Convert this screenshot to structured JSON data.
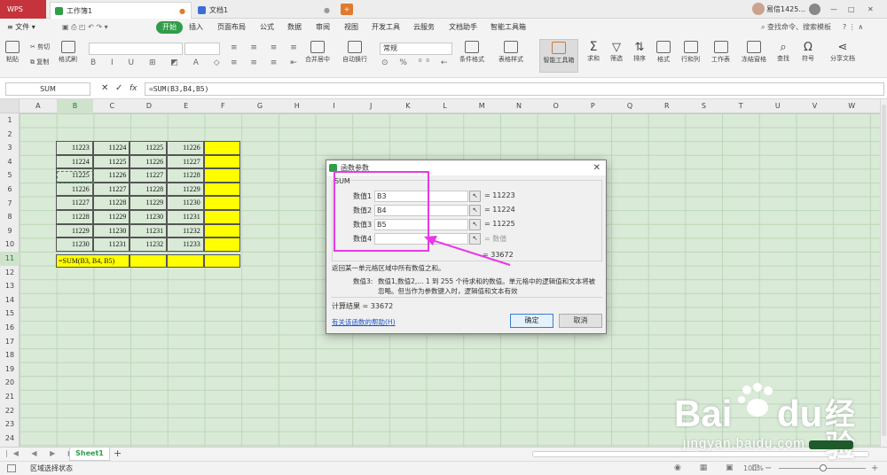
{
  "tabs": {
    "app": "WPS",
    "workbook": "工作簿1",
    "document": "文档1",
    "user": "易信1425..."
  },
  "menu": {
    "file": "文件",
    "items": [
      "开始",
      "插入",
      "页面布局",
      "公式",
      "数据",
      "审阅",
      "视图",
      "开发工具",
      "云服务",
      "文档助手",
      "智能工具箱"
    ],
    "search": "查找命令、搜索模板"
  },
  "ribbon": {
    "cut": "剪切",
    "copy": "复制",
    "paste": "粘贴",
    "format_painter": "格式刷",
    "merge": "合并居中",
    "wrap": "自动换行",
    "number_format": "常规",
    "cond_format": "条件格式",
    "table_style": "表格样式",
    "smart_toolbox": "智能工具箱",
    "sum": "求和",
    "filter": "筛选",
    "sort": "排序",
    "format": "格式",
    "rows_cols": "行和列",
    "worksheet": "工作表",
    "freeze": "冻结窗格",
    "find": "查找",
    "symbol": "符号",
    "share": "分享文档"
  },
  "formula_bar": {
    "name_box": "SUM",
    "fx": "fx",
    "formula": "=SUM(B3,B4,B5)"
  },
  "columns": [
    "A",
    "B",
    "C",
    "D",
    "E",
    "F",
    "G",
    "H",
    "I",
    "J",
    "K",
    "L",
    "M",
    "N",
    "O",
    "P",
    "Q",
    "R",
    "S",
    "T",
    "U",
    "V",
    "W"
  ],
  "rows": [
    "1",
    "2",
    "3",
    "4",
    "5",
    "6",
    "7",
    "8",
    "9",
    "10",
    "11",
    "12",
    "13",
    "14",
    "15",
    "16",
    "17",
    "18",
    "19",
    "20",
    "21",
    "22",
    "23",
    "24"
  ],
  "table": [
    [
      "11223",
      "11224",
      "11225",
      "11226"
    ],
    [
      "11224",
      "11225",
      "11226",
      "11227"
    ],
    [
      "11225",
      "11226",
      "11227",
      "11228"
    ],
    [
      "11226",
      "11227",
      "11228",
      "11229"
    ],
    [
      "11227",
      "11228",
      "11229",
      "11230"
    ],
    [
      "11228",
      "11229",
      "11230",
      "11231"
    ],
    [
      "11229",
      "11230",
      "11231",
      "11232"
    ],
    [
      "11230",
      "11231",
      "11232",
      "11233"
    ]
  ],
  "cell_formula": "=SUM(B3, B4, B5)",
  "dialog": {
    "title": "函数参数",
    "function_name": "SUM",
    "args": [
      {
        "label": "数值1",
        "value": "B3",
        "result": "= 11223"
      },
      {
        "label": "数值2",
        "value": "B4",
        "result": "= 11224"
      },
      {
        "label": "数值3",
        "value": "B5",
        "result": "= 11225"
      },
      {
        "label": "数值4",
        "value": "",
        "result": "= 数值"
      }
    ],
    "total": "= 33672",
    "description": "返回某一单元格区域中所有数值之和。",
    "param_label": "数值3:",
    "param_desc_1": "数值1,数值2,... 1 到 255 个待求和的数值。单元格中的逻辑值和文本将被",
    "param_desc_2": "忽略。但当作为参数键入时，逻辑值和文本有效",
    "calc_result": "计算结果 = 33672",
    "help_link": "有关该函数的帮助(H)",
    "ok": "确定",
    "cancel": "取消"
  },
  "sheet_tab": "Sheet1",
  "status_text": "区域选择状态",
  "zoom": "100%",
  "watermark": {
    "brand": "Bai",
    "brand2": "du",
    "cn": "经验",
    "url": "jingyan.baidu.com"
  },
  "colors": {
    "accent": "#2f9e48",
    "annotation": "#e838e8",
    "highlight": "#ffff00",
    "grid_bg": "#d9ead7"
  }
}
